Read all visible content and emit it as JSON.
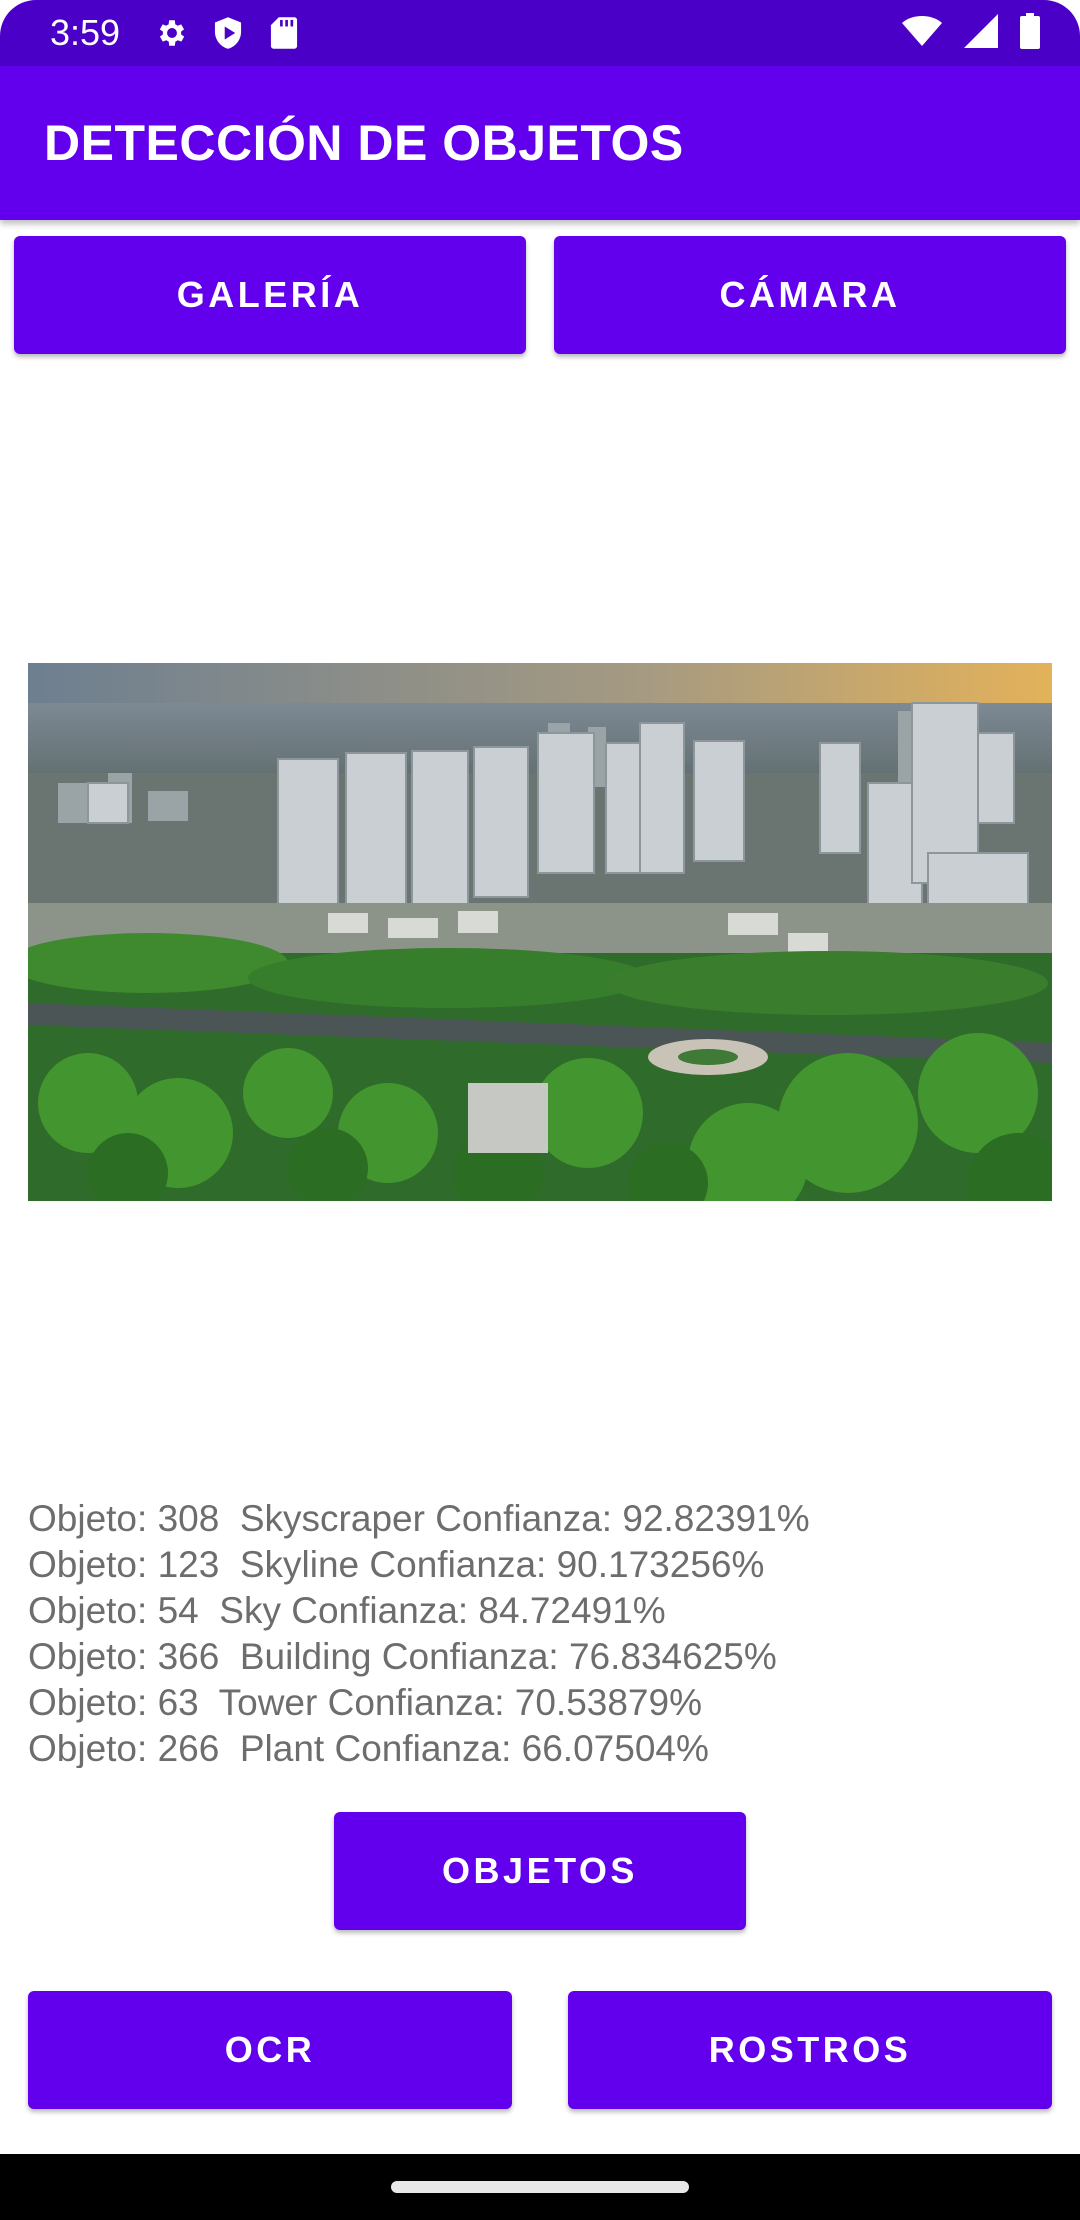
{
  "status_bar": {
    "time": "3:59",
    "icons": [
      "gear-icon",
      "play-shield-icon",
      "sd-card-icon",
      "wifi-icon",
      "signal-icon",
      "battery-icon"
    ]
  },
  "app_bar": {
    "title": "DETECCIÓN DE OBJETOS"
  },
  "top_buttons": {
    "gallery": "GALERÍA",
    "camera": "CÁMARA"
  },
  "results": [
    "Objeto: 308  Skyscraper Confianza: 92.82391%",
    "Objeto: 123  Skyline Confianza: 90.173256%",
    "Objeto: 54  Sky Confianza: 84.72491%",
    "Objeto: 366  Building Confianza: 76.834625%",
    "Objeto: 63  Tower Confianza: 70.53879%",
    "Objeto: 266  Plant Confianza: 66.07504%"
  ],
  "bottom_buttons": {
    "objects": "OBJETOS",
    "ocr": "OCR",
    "faces": "ROSTROS"
  },
  "colors": {
    "primary": "#6200ee",
    "status_bar": "#4b00c7",
    "result_text": "#6d6d6d"
  }
}
